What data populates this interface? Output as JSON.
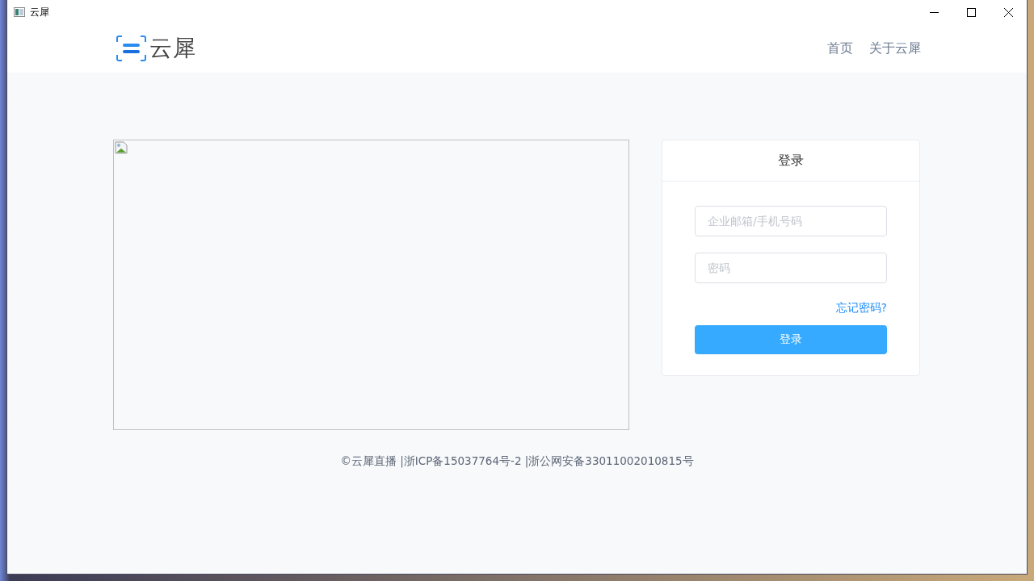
{
  "window": {
    "title": "云犀"
  },
  "header": {
    "logo_text": "云犀",
    "nav": [
      {
        "label": "首页"
      },
      {
        "label": "关于云犀"
      }
    ]
  },
  "login": {
    "title": "登录",
    "fields": [
      {
        "placeholder": "企业邮箱/手机号码"
      },
      {
        "placeholder": "密码"
      }
    ],
    "forgot_link": "忘记密码?",
    "submit": "登录"
  },
  "footer": "©云犀直播 |浙ICP备15037764号-2 |浙公网安备33011002010815号"
}
